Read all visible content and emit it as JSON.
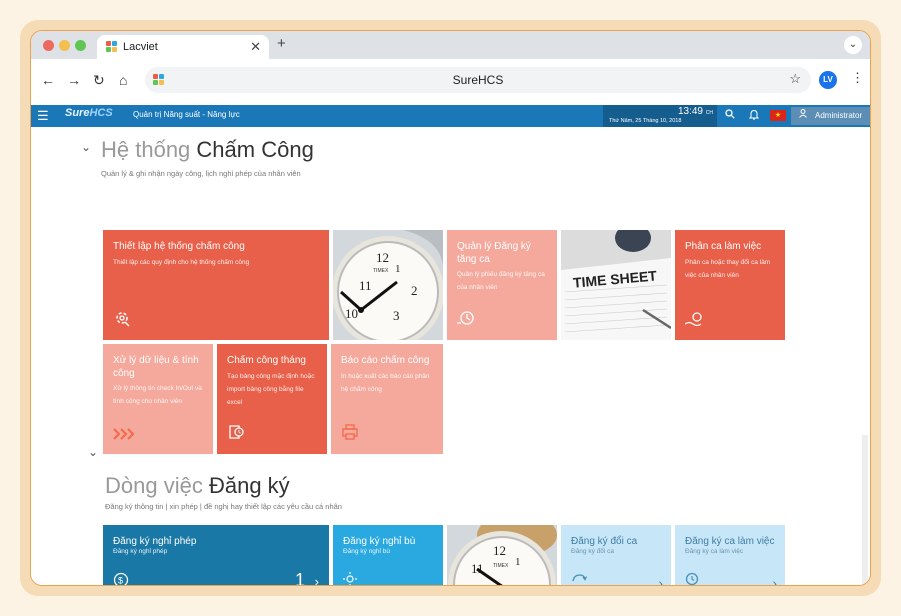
{
  "browser": {
    "tab_title": "Lacviet",
    "tab_close": "✕",
    "new_tab": "+",
    "url": "SureHCS",
    "avatar_initials": "LV"
  },
  "app": {
    "logo_prefix": "Sure",
    "logo_suffix": "HCS",
    "module_title": "Quản trị Năng suất - Năng lực",
    "time": "13:49",
    "time_suffix": "CH",
    "date": "Thứ Năm, 25 Tháng 10, 2018",
    "user": "Administrator"
  },
  "sections": {
    "attendance": {
      "title_light": "Hệ thống",
      "title_dark": "Chấm Công",
      "subtitle": "Quản lý & ghi nhận ngày công, lịch nghỉ phép của nhân viên",
      "tiles": {
        "setup": {
          "title": "Thiết lập hệ thống chấm công",
          "desc": "Thiết lập các quy định cho hệ thống chấm công"
        },
        "shift_reg": {
          "title": "Quản lý Đăng ký tăng ca",
          "desc": "Quản lý phiếu đăng ký tăng ca của nhân viên"
        },
        "shift_assign": {
          "title": "Phân ca làm việc",
          "desc": "Phân ca hoặc thay đổi ca làm việc của nhân viên"
        },
        "process": {
          "title": "Xử lý dữ liệu & tính công",
          "desc": "Xử lý thông tin check In/Out và tính công cho nhân viên"
        },
        "monthly": {
          "title": "Chấm công tháng",
          "desc": "Tạo bảng công mặc định hoặc import bảng công bằng file excel"
        },
        "report": {
          "title": "Báo cáo chấm công",
          "desc": "In hoặc xuất các báo cáo phân hệ chấm công"
        }
      },
      "photo_text": "TIME SHEET"
    },
    "workflow": {
      "title_light": "Dòng việc",
      "title_dark": "Đăng ký",
      "subtitle": "Đăng ký thông tin | xin phép | đề nghị hay thiết lập các yêu cầu cá nhân",
      "tiles": {
        "leave": {
          "title": "Đăng ký nghỉ phép",
          "desc": "Đăng ký nghỉ phép",
          "count": "1"
        },
        "comp": {
          "title": "Đăng ký nghỉ bù",
          "desc": "Đăng ký nghỉ bù"
        },
        "swap": {
          "title": "Đăng ký đổi ca",
          "desc": "Đăng ký đổi ca"
        },
        "shift": {
          "title": "Đăng ký ca làm việc",
          "desc": "Đăng ký ca làm việc"
        }
      }
    }
  },
  "colors": {
    "header": "#1a78b8",
    "tile_red": "#e9604a",
    "tile_pink": "#f5a99c",
    "tile_blue_dark": "#1a78a6",
    "tile_blue_mid": "#2aa8e0",
    "tile_blue_light": "#c7e6f7"
  },
  "icons": {
    "hamburger": "hamburger-menu-icon",
    "search": "search-icon",
    "bell": "bell-icon",
    "user": "user-icon"
  }
}
